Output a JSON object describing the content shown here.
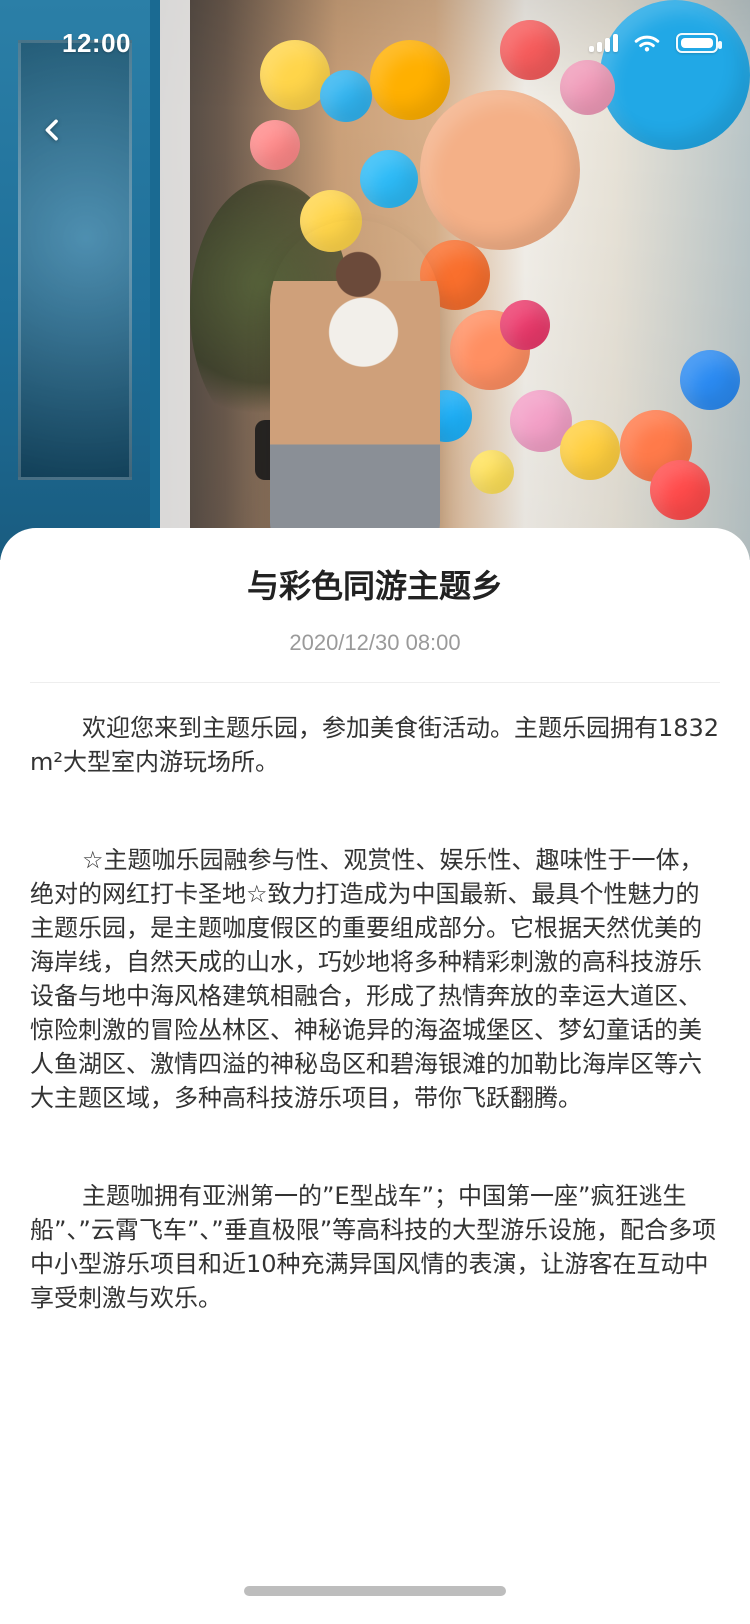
{
  "status_bar": {
    "time": "12:00"
  },
  "navigation": {
    "back_icon": "chevron-left-icon"
  },
  "hero": {
    "image": "balloon-wall-photo"
  },
  "article": {
    "title": "与彩色同游主题乡",
    "date": "2020/12/30 08:00",
    "paragraphs": [
      "欢迎您来到主题乐园，参加美食街活动。主题乐园拥有1832m²大型室内游玩场所。",
      "☆主题咖乐园融参与性、观赏性、娱乐性、趣味性于一体，绝对的网红打卡圣地☆致力打造成为中国最新、最具个性魅力的主题乐园，是主题咖度假区的重要组成部分。它根据天然优美的海岸线，自然天成的山水，巧妙地将多种精彩刺激的高科技游乐设备与地中海风格建筑相融合，形成了热情奔放的幸运大道区、惊险刺激的冒险丛林区、神秘诡异的海盗城堡区、梦幻童话的美人鱼湖区、激情四溢的神秘岛区和碧海银滩的加勒比海岸区等六大主题区域，多种高科技游乐项目，带你飞跃翻腾。",
      "主题咖拥有亚洲第一的”E型战车”；中国第一座”疯狂逃生船”、”云霄飞车”、”垂直极限”等高科技的大型游乐设施，配合多项中小型游乐项目和近10种充满异国风情的表演，让游客在互动中享受刺激与欢乐。"
    ]
  }
}
